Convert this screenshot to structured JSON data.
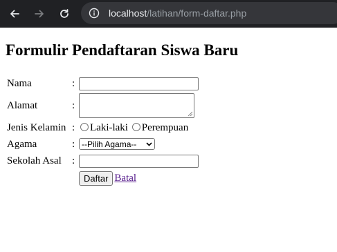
{
  "browser": {
    "url_host": "localhost",
    "url_path": "/latihan/form-daftar.php",
    "icons": [
      "back-arrow-icon",
      "forward-arrow-icon",
      "reload-icon",
      "info-icon"
    ]
  },
  "page": {
    "title": "Formulir Pendaftaran Siswa Baru"
  },
  "form": {
    "separator": ":",
    "nama_label": "Nama",
    "alamat_label": "Alamat",
    "jenis_kelamin_label": "Jenis Kelamin",
    "gender_options": [
      "Laki-laki",
      "Perempuan"
    ],
    "agama_label": "Agama",
    "agama_selected": "--Pilih Agama--",
    "sekolah_label": "Sekolah Asal",
    "submit_label": "Daftar",
    "cancel_label": "Batal"
  }
}
